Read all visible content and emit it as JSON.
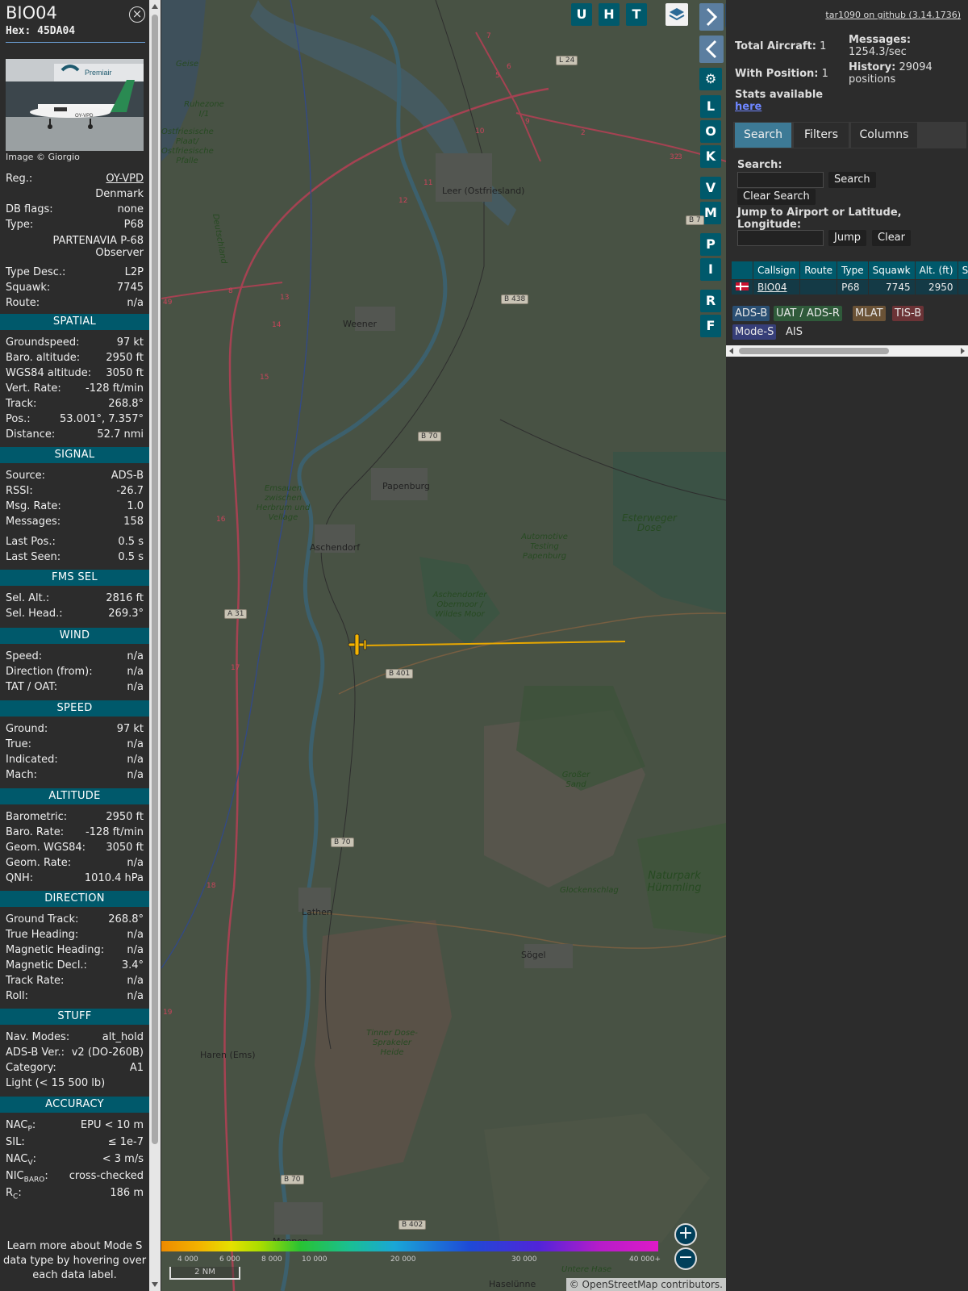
{
  "aircraft": {
    "callsign": "BIO04",
    "hex_line": "Hex: 45DA04",
    "image_credit": "Image © Giorgio",
    "photo_airline_text": "Premiair",
    "photo_reg_text": "OY-VPD",
    "learn_more": "Learn more about Mode S data type by hovering over each data label."
  },
  "details": [
    {
      "label": "Reg.:",
      "value": "OY-VPD",
      "link": true
    },
    {
      "label": "",
      "value": "Denmark"
    },
    {
      "label": "DB flags:",
      "value": "none"
    },
    {
      "label": "Type:",
      "value": "P68"
    },
    {
      "label": "",
      "value": "PARTENAVIA P-68 Observer"
    },
    {
      "label": "Type Desc.:",
      "value": "L2P"
    },
    {
      "label": "Squawk:",
      "value": "7745"
    },
    {
      "label": "Route:",
      "value": "n/a"
    }
  ],
  "sections": {
    "spatial": {
      "title": "SPATIAL",
      "rows": [
        {
          "label": "Groundspeed:",
          "value": "97 kt"
        },
        {
          "label": "Baro. altitude:",
          "value": "2950 ft"
        },
        {
          "label": "WGS84 altitude:",
          "value": "3050 ft"
        },
        {
          "label": "Vert. Rate:",
          "value": "-128 ft/min"
        },
        {
          "label": "Track:",
          "value": "268.8°"
        },
        {
          "label": "Pos.:",
          "value": "53.001°, 7.357°"
        },
        {
          "label": "Distance:",
          "value": "52.7 nmi"
        }
      ]
    },
    "signal": {
      "title": "SIGNAL",
      "rows": [
        {
          "label": "Source:",
          "value": "ADS-B"
        },
        {
          "label": "RSSI:",
          "value": "-26.7"
        },
        {
          "label": "Msg. Rate:",
          "value": "1.0"
        },
        {
          "label": "Messages:",
          "value": "158"
        },
        {
          "label": "Last Pos.:",
          "value": "0.5 s"
        },
        {
          "label": "Last Seen:",
          "value": "0.5 s"
        }
      ]
    },
    "fms": {
      "title": "FMS SEL",
      "rows": [
        {
          "label": "Sel. Alt.:",
          "value": "2816 ft"
        },
        {
          "label": "Sel. Head.:",
          "value": "269.3°"
        }
      ]
    },
    "wind": {
      "title": "WIND",
      "rows": [
        {
          "label": "Speed:",
          "value": "n/a"
        },
        {
          "label": "Direction (from):",
          "value": "n/a"
        },
        {
          "label": "TAT / OAT:",
          "value": "n/a"
        }
      ]
    },
    "speed": {
      "title": "SPEED",
      "rows": [
        {
          "label": "Ground:",
          "value": "97 kt"
        },
        {
          "label": "True:",
          "value": "n/a"
        },
        {
          "label": "Indicated:",
          "value": "n/a"
        },
        {
          "label": "Mach:",
          "value": "n/a"
        }
      ]
    },
    "altitude": {
      "title": "ALTITUDE",
      "rows": [
        {
          "label": "Barometric:",
          "value": "2950 ft"
        },
        {
          "label": "Baro. Rate:",
          "value": "-128 ft/min"
        },
        {
          "label": "Geom. WGS84:",
          "value": "3050 ft"
        },
        {
          "label": "Geom. Rate:",
          "value": "n/a"
        },
        {
          "label": "QNH:",
          "value": "1010.4 hPa"
        }
      ]
    },
    "direction": {
      "title": "DIRECTION",
      "rows": [
        {
          "label": "Ground Track:",
          "value": "268.8°"
        },
        {
          "label": "True Heading:",
          "value": "n/a"
        },
        {
          "label": "Magnetic Heading:",
          "value": "n/a"
        },
        {
          "label": "Magnetic Decl.:",
          "value": "3.4°"
        },
        {
          "label": "Track Rate:",
          "value": "n/a"
        },
        {
          "label": "Roll:",
          "value": "n/a"
        }
      ]
    },
    "stuff": {
      "title": "STUFF",
      "rows": [
        {
          "label": "Nav. Modes:",
          "value": "alt_hold"
        },
        {
          "label": "ADS-B Ver.:",
          "value": "v2 (DO-260B)"
        },
        {
          "label": "Category:",
          "value": "A1"
        },
        {
          "label": "Light (< 15 500 lb)",
          "value": ""
        }
      ]
    },
    "accuracy": {
      "title": "ACCURACY",
      "rows": [
        {
          "label": "NAC",
          "sub": "P",
          "value": "EPU < 10 m"
        },
        {
          "label": "SIL:",
          "value": "≤ 1e-7"
        },
        {
          "label": "NAC",
          "sub": "V",
          "value": "< 3 m/s"
        },
        {
          "label": "NIC",
          "sub": "BARO",
          "value": "cross-checked"
        },
        {
          "label": "R",
          "sub": "C",
          "value": "186 m"
        }
      ]
    }
  },
  "map": {
    "buttons_top": [
      "U",
      "H",
      "T"
    ],
    "side_buttons": [
      "L",
      "O",
      "K",
      "V",
      "M",
      "P",
      "I",
      "R",
      "F"
    ],
    "places": [
      "Leer (Ostfriesland)",
      "Weener",
      "Papenburg",
      "Aschendorf",
      "Lathen",
      "Sögel",
      "Haren (Ems)",
      "Meppen",
      "Haselünne"
    ],
    "nature": [
      "Ruhezone I/1",
      "Ostfriesische Plaat/ Ostfriesische Pfalle",
      "Emsauen zwischen Herbrum und Vellage",
      "Automotive Testing Papenburg",
      "Aschendorfer Obermoor / Wildes Moor",
      "Esterweger Dose",
      "Großer Sand",
      "Naturpark Hümmling",
      "Glockenschlag",
      "Tinner Dose-Sprakeler Heide",
      "Geise",
      "Deutschland",
      "Untere Hase"
    ],
    "road_badges": [
      "L 24",
      "B 438",
      "B 70",
      "A 31",
      "B 401",
      "B 70",
      "B 70",
      "B 402",
      "B 7"
    ],
    "route_numbers": [
      "7",
      "6",
      "5",
      "10",
      "9",
      "2",
      "3",
      "11",
      "12",
      "13",
      "14",
      "15",
      "16",
      "17",
      "18",
      "19",
      "32",
      "49",
      "8"
    ],
    "colorbar_ticks": [
      "4 000",
      "6 000",
      "8 000",
      "10 000",
      "20 000",
      "30 000",
      "40 000+"
    ],
    "scale_label": "2 NM",
    "attribution": "© OpenStreetMap contributors.",
    "zoom_in": "+",
    "zoom_out": "−"
  },
  "right": {
    "github_link": "tar1090 on github (3.14.1736)",
    "total_label": "Total Aircraft:",
    "total_value": "1",
    "withpos_label": "With Position:",
    "withpos_value": "1",
    "messages_label": "Messages:",
    "messages_value": "1254.3/sec",
    "history_label": "History:",
    "history_value": "29094 positions",
    "stats_label": "Stats available",
    "stats_link": "here",
    "tabs": [
      "Search",
      "Filters",
      "Columns"
    ],
    "search_label": "Search:",
    "search_button": "Search",
    "clear_search_button": "Clear Search",
    "jump_label": "Jump to Airport or Latitude, Longitude:",
    "jump_button": "Jump",
    "clear_button": "Clear",
    "table_headers": [
      "",
      "Callsign",
      "Route",
      "Type",
      "Squawk",
      "Alt. (ft)",
      "Spd."
    ],
    "table_rows": [
      [
        "",
        "BIO04",
        "",
        "P68",
        "7745",
        "2950",
        ""
      ]
    ],
    "sources": [
      "ADS-B",
      "UAT / ADS-R",
      "MLAT",
      "TIS-B",
      "Mode-S",
      "AIS"
    ]
  },
  "colors": {
    "accent": "#00596b",
    "active_tab": "#3d7a96",
    "aircraft": "#f5b400",
    "track": "#e9a800"
  }
}
